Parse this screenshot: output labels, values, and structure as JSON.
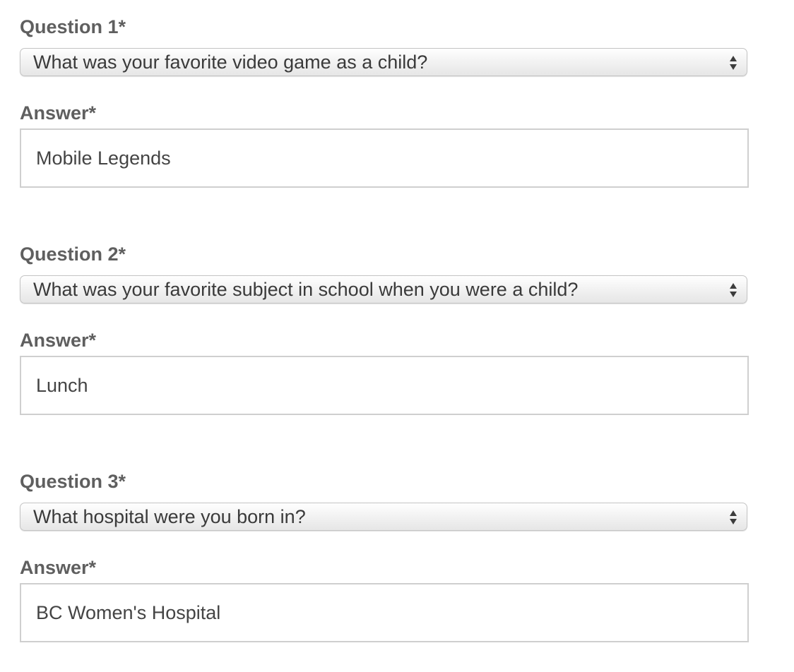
{
  "questions": [
    {
      "label": "Question 1*",
      "selected": "What was your favorite video game as a child?",
      "answer_label": "Answer*",
      "answer": "Mobile Legends"
    },
    {
      "label": "Question 2*",
      "selected": "What was your favorite subject in school when you were a child?",
      "answer_label": "Answer*",
      "answer": "Lunch"
    },
    {
      "label": "Question 3*",
      "selected": "What hospital were you born in?",
      "answer_label": "Answer*",
      "answer": "BC Women's Hospital"
    }
  ],
  "icons": {
    "select_arrows": "up-down-chevron-icon"
  },
  "colors": {
    "label": "#5f5f5f",
    "input_text": "#444444",
    "border": "#cfcfcf"
  }
}
